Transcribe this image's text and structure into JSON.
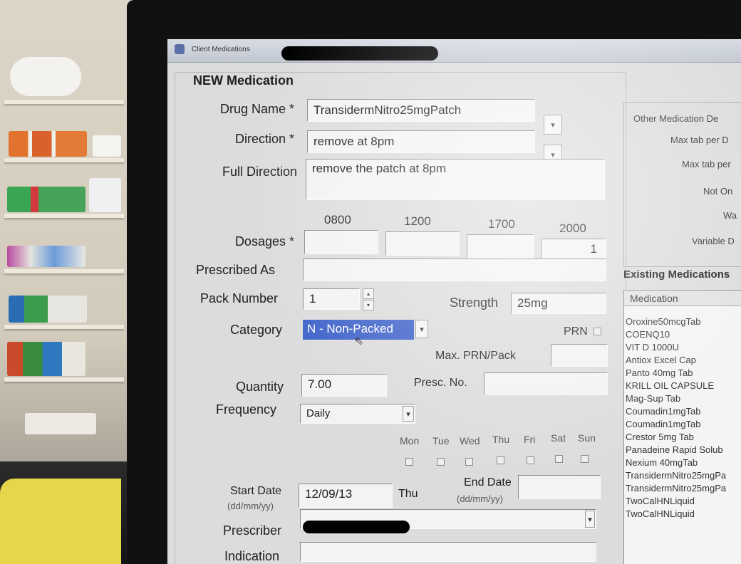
{
  "window": {
    "title": "Client Medications"
  },
  "form": {
    "section_title": "NEW Medication",
    "drug_name": {
      "label": "Drug Name *",
      "value": "TransidermNitro25mgPatch"
    },
    "direction": {
      "label": "Direction *",
      "value": "remove at 8pm"
    },
    "full_direction": {
      "label": "Full Direction",
      "value": "remove the patch at 8pm"
    },
    "dosages": {
      "label": "Dosages *",
      "times": [
        "0800",
        "1200",
        "1700",
        "2000"
      ],
      "values": [
        "",
        "",
        "",
        "1"
      ]
    },
    "prescribed_as": {
      "label": "Prescribed As",
      "value": ""
    },
    "pack_number": {
      "label": "Pack Number",
      "value": "1"
    },
    "strength": {
      "label": "Strength",
      "value": "25mg"
    },
    "category": {
      "label": "Category",
      "value": "N - Non-Packed"
    },
    "prn": {
      "label": "PRN",
      "checked": false
    },
    "max_prn": {
      "label": "Max. PRN/Pack",
      "value": ""
    },
    "quantity": {
      "label": "Quantity",
      "value": "7.00"
    },
    "presc_no": {
      "label": "Presc. No.",
      "value": ""
    },
    "frequency": {
      "label": "Frequency",
      "value": "Daily"
    },
    "days": [
      "Mon",
      "Tue",
      "Wed",
      "Thu",
      "Fri",
      "Sat",
      "Sun"
    ],
    "start_date": {
      "label": "Start Date",
      "format": "(dd/mm/yy)",
      "value": "12/09/13",
      "weekday": "Thu"
    },
    "end_date": {
      "label": "End Date",
      "format": "(dd/mm/yy)",
      "value": ""
    },
    "prescriber": {
      "label": "Prescriber"
    },
    "indication": {
      "label": "Indication"
    }
  },
  "other_details": {
    "title": "Other Medication De",
    "rows": [
      "Max tab per D",
      "Max tab per",
      "Not On",
      "Wa",
      "Variable D"
    ]
  },
  "existing": {
    "title": "Existing Medications",
    "column": "Medication",
    "items": [
      "Oroxine50mcgTab",
      "COENQ10",
      "VIT D 1000U",
      "Antiox Excel Cap",
      "Panto 40mg Tab",
      "KRILL OIL CAPSULE",
      "Mag-Sup Tab",
      "Coumadin1mgTab",
      "Coumadin1mgTab",
      "Crestor 5mg Tab",
      "Panadeine Rapid Solub",
      "Nexium 40mgTab",
      "TransidermNitro25mgPa",
      "TransidermNitro25mgPa",
      "TwoCalHNLiquid",
      "TwoCalHNLiquid"
    ]
  }
}
